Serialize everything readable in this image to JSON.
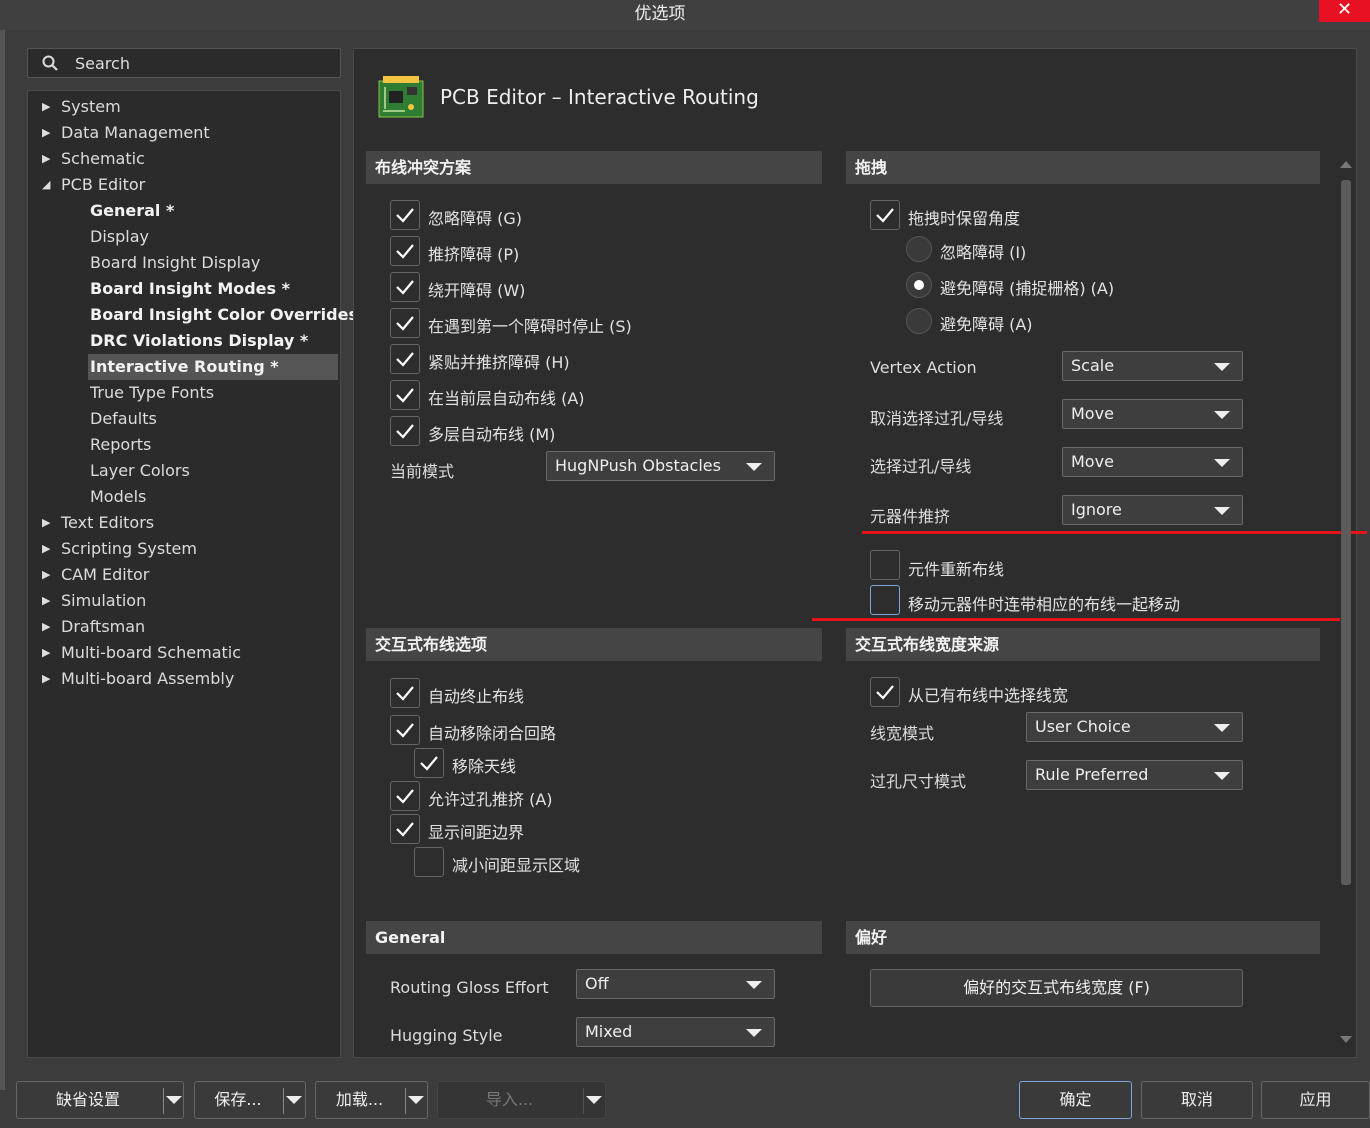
{
  "window": {
    "title": "优选项",
    "close_glyph": "✕"
  },
  "search": {
    "placeholder": "Search"
  },
  "tree": {
    "items": [
      {
        "label": "System",
        "level": 0,
        "expanded": false
      },
      {
        "label": "Data Management",
        "level": 0,
        "expanded": false
      },
      {
        "label": "Schematic",
        "level": 0,
        "expanded": false
      },
      {
        "label": "PCB Editor",
        "level": 0,
        "expanded": true
      },
      {
        "label": "General *",
        "level": 1,
        "bold": true
      },
      {
        "label": "Display",
        "level": 1
      },
      {
        "label": "Board Insight Display",
        "level": 1
      },
      {
        "label": "Board Insight Modes *",
        "level": 1,
        "bold": true
      },
      {
        "label": "Board Insight Color Overrides *",
        "level": 1,
        "bold": true
      },
      {
        "label": "DRC Violations Display *",
        "level": 1,
        "bold": true
      },
      {
        "label": "Interactive Routing *",
        "level": 1,
        "bold": true,
        "selected": true
      },
      {
        "label": "True Type Fonts",
        "level": 1
      },
      {
        "label": "Defaults",
        "level": 1
      },
      {
        "label": "Reports",
        "level": 1
      },
      {
        "label": "Layer Colors",
        "level": 1
      },
      {
        "label": "Models",
        "level": 1
      },
      {
        "label": "Text Editors",
        "level": 0,
        "expanded": false
      },
      {
        "label": "Scripting System",
        "level": 0,
        "expanded": false
      },
      {
        "label": "CAM Editor",
        "level": 0,
        "expanded": false
      },
      {
        "label": "Simulation",
        "level": 0,
        "expanded": false
      },
      {
        "label": "Draftsman",
        "level": 0,
        "expanded": false
      },
      {
        "label": "Multi-board Schematic",
        "level": 0,
        "expanded": false
      },
      {
        "label": "Multi-board Assembly",
        "level": 0,
        "expanded": false
      }
    ]
  },
  "page": {
    "title": "PCB Editor – Interactive Routing"
  },
  "conflict": {
    "header": "布线冲突方案",
    "options": [
      {
        "label": "忽略障碍 (G)",
        "checked": true
      },
      {
        "label": "推挤障碍 (P)",
        "checked": true
      },
      {
        "label": "绕开障碍 (W)",
        "checked": true
      },
      {
        "label": "在遇到第一个障碍时停止 (S)",
        "checked": true
      },
      {
        "label": "紧贴并推挤障碍 (H)",
        "checked": true
      },
      {
        "label": "在当前层自动布线 (A)",
        "checked": true
      },
      {
        "label": "多层自动布线 (M)",
        "checked": true
      }
    ],
    "mode_label": "当前模式",
    "mode_value": "HugNPush Obstacles"
  },
  "drag": {
    "header": "拖拽",
    "preserve_angle": "拖拽时保留角度",
    "preserve_checked": true,
    "radios": [
      {
        "label": "忽略障碍 (I)",
        "selected": false
      },
      {
        "label": "避免障碍 (捕捉栅格) (A)",
        "selected": true
      },
      {
        "label": "避免障碍 (A)",
        "selected": false
      }
    ],
    "vertex_label": "Vertex Action",
    "vertex_value": "Scale",
    "unselect_label": "取消选择过孔/导线",
    "unselect_value": "Move",
    "select_label": "选择过孔/导线",
    "select_value": "Move",
    "push_label": "元器件推挤",
    "push_value": "Ignore",
    "reroute_label": "元件重新布线",
    "reroute_checked": false,
    "move_with_label": "移动元器件时连带相应的布线一起移动",
    "move_with_checked": false
  },
  "interactive": {
    "header": "交互式布线选项",
    "options": [
      {
        "label": "自动终止布线",
        "checked": true,
        "indent": false
      },
      {
        "label": "自动移除闭合回路",
        "checked": true,
        "indent": false
      },
      {
        "label": "移除天线",
        "checked": true,
        "indent": true
      },
      {
        "label": "允许过孔推挤 (A)",
        "checked": true,
        "indent": false
      },
      {
        "label": "显示间距边界",
        "checked": true,
        "indent": false
      },
      {
        "label": "减小间距显示区域",
        "checked": false,
        "indent": true
      }
    ]
  },
  "width_source": {
    "header": "交互式布线宽度来源",
    "pick_label": "从已有布线中选择线宽",
    "pick_checked": true,
    "width_mode_label": "线宽模式",
    "width_mode_value": "User Choice",
    "via_mode_label": "过孔尺寸模式",
    "via_mode_value": "Rule Preferred"
  },
  "general": {
    "header": "General",
    "gloss_label": "Routing Gloss Effort",
    "gloss_value": "Off",
    "hug_label": "Hugging Style",
    "hug_value": "Mixed"
  },
  "pref": {
    "header": "偏好",
    "button": "偏好的交互式布线宽度 (F)"
  },
  "footer": {
    "default": "缺省设置",
    "save": "保存...",
    "load": "加载...",
    "import": "导入...",
    "ok": "确定",
    "cancel": "取消",
    "apply": "应用"
  },
  "colors": {
    "accent_red": "#e4141b",
    "selected_bg": "#555555"
  }
}
